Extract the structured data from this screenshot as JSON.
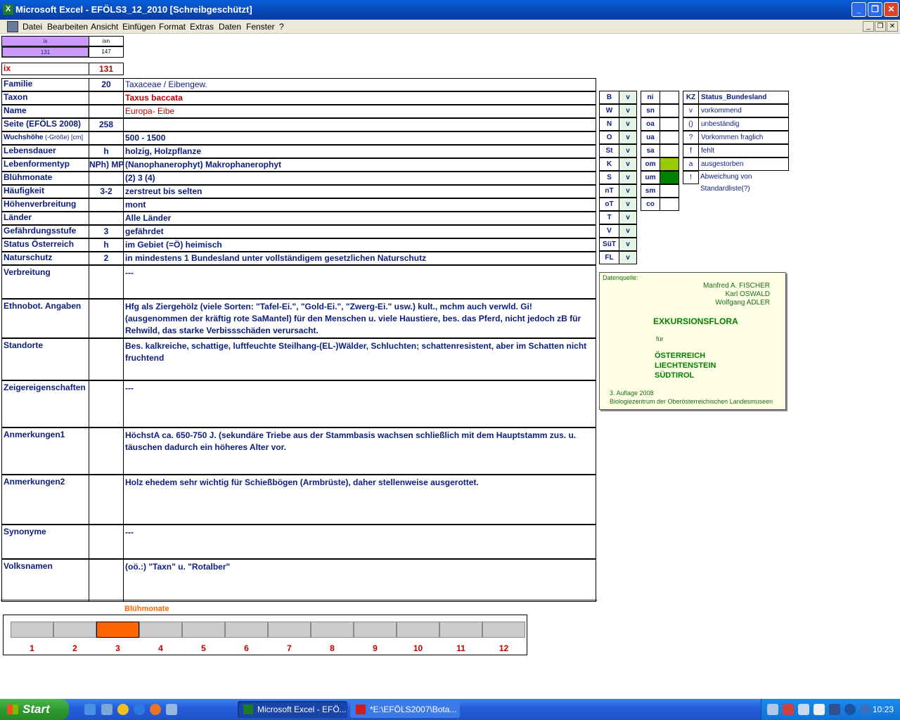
{
  "window": {
    "title": "Microsoft Excel - EFÖLS3_12_2010  [Schreibgeschützt]",
    "app_icon": "X",
    "min_label": "_",
    "max_label": "❐",
    "close_label": "✕"
  },
  "menu": {
    "items": [
      "Datei",
      "Bearbeiten",
      "Ansicht",
      "Einfügen",
      "Format",
      "Extras",
      "Daten",
      "Fenster",
      "?"
    ]
  },
  "top": {
    "ix_header": "ix",
    "ixn_header": "ixn",
    "ix_value": "131",
    "ixn_value": "147",
    "ix_label": "ix",
    "ix_big": "131"
  },
  "rows": [
    {
      "label": "Familie",
      "code": "20",
      "value": "Taxaceae  /  Eibengew."
    },
    {
      "label": "Taxon",
      "code": "",
      "value": "Taxus baccata"
    },
    {
      "label": "Name",
      "code": "",
      "value": "Europa- Eibe"
    },
    {
      "label": "Seite (EFÖLS 2008)",
      "code": "258",
      "value": ""
    },
    {
      "label": "Wuchshöhe",
      "label_suffix": " (-Größe) [cm]",
      "code": "",
      "value": "500 - 1500"
    },
    {
      "label": "Lebensdauer",
      "code": "h",
      "value": "holzig, Holzpflanze"
    },
    {
      "label": "Lebenformentyp",
      "code": "NPh) MPh",
      "value": "(Nanophanerophyt) Makrophanerophyt"
    },
    {
      "label": "Blühmonate",
      "code": "",
      "value": "(2) 3 (4)"
    },
    {
      "label": "Häufigkeit",
      "code": "3-2",
      "value": "zerstreut bis selten"
    },
    {
      "label": "Höhenverbreitung",
      "code": "",
      "value": "mont"
    },
    {
      "label": "Länder",
      "code": "",
      "value": "Alle Länder"
    },
    {
      "label": "Gefährdungsstufe",
      "code": "3",
      "value": "gefährdet"
    },
    {
      "label": "Status Österreich",
      "code": "h",
      "value": "im Gebiet (=Ö) heimisch"
    },
    {
      "label": "Naturschutz",
      "code": "2",
      "value": "in mindestens 1 Bundesland unter vollständigem gesetzlichen Naturschutz"
    }
  ],
  "big_rows": [
    {
      "label": "Verbreitung",
      "value": "---"
    },
    {
      "label": "Ethnobot. Angaben",
      "value": "Hfg als Ziergehölz (viele Sorten: \"Tafel-Ei.\", \"Gold-Ei.\", \"Zwerg-Ei.\" usw.) kult., mchm auch verwld. Gi! (ausgenommen der kräftig rote SaMantel) für den Menschen u. viele Haustiere, bes. das Pferd, nicht jedoch zB für Rehwild, das starke Verbissschäden verursacht."
    },
    {
      "label": "Standorte",
      "value": "Bes. kalkreiche, schattige, luftfeuchte Steilhang-(EL-)Wälder, Schluchten; schattenresistent, aber im Schatten nicht fruchtend"
    },
    {
      "label": "Zeigereigenschaften",
      "value": "---"
    },
    {
      "label": "Anmerkungen1",
      "value": "HöchstA ca. 650-750 J. (sekundäre Triebe aus der Stammbasis wachsen schließlich mit dem Hauptstamm zus. u. täuschen dadurch ein höheres Alter vor."
    },
    {
      "label": "Anmerkungen2",
      "value": "Holz ehedem sehr wichtig für Schießbögen (Armbrüste), daher stellenweise ausgerottet."
    },
    {
      "label": "Synonyme",
      "value": "---"
    },
    {
      "label": "Volksnamen",
      "value": "(oö.:) \"Taxn\" u. \"Rotalber\""
    }
  ],
  "legend1": [
    {
      "k": "B",
      "v": "v"
    },
    {
      "k": "W",
      "v": "v"
    },
    {
      "k": "N",
      "v": "v"
    },
    {
      "k": "O",
      "v": "v"
    },
    {
      "k": "St",
      "v": "v"
    },
    {
      "k": "K",
      "v": "v"
    },
    {
      "k": "S",
      "v": "v"
    },
    {
      "k": "nT",
      "v": "v"
    },
    {
      "k": "oT",
      "v": "v"
    },
    {
      "k": "T",
      "v": "v"
    },
    {
      "k": "V",
      "v": "v"
    },
    {
      "k": "SüT",
      "v": "v"
    },
    {
      "k": "FL",
      "v": "v"
    }
  ],
  "legend2": [
    {
      "k": "ni",
      "fill": ""
    },
    {
      "k": "sn",
      "fill": ""
    },
    {
      "k": "oa",
      "fill": ""
    },
    {
      "k": "ua",
      "fill": ""
    },
    {
      "k": "sa",
      "fill": ""
    },
    {
      "k": "om",
      "fill": "#99cc00"
    },
    {
      "k": "um",
      "fill": "#008000"
    },
    {
      "k": "sm",
      "fill": ""
    },
    {
      "k": "co",
      "fill": ""
    }
  ],
  "legend3": {
    "header_kz": "KZ",
    "header_title": "Status_Bundesland",
    "items": [
      {
        "k": "v",
        "t": "vorkommend"
      },
      {
        "k": "()",
        "t": "unbeständig"
      },
      {
        "k": "?",
        "t": "Vorkommen fraglich"
      },
      {
        "k": "f",
        "t": "fehlt"
      },
      {
        "k": "a",
        "t": "ausgestorben"
      },
      {
        "k": "!",
        "t": "Abweichung von Standardliste(?)"
      }
    ]
  },
  "source": {
    "label": "Datenquelle:",
    "author1": "Manfred A. FISCHER",
    "author2": "Karl OSWALD",
    "author3": "Wolfgang ADLER",
    "title": "EXKURSIONSFLORA",
    "fuer": "für",
    "country1": "ÖSTERREICH",
    "country2": "LIECHTENSTEIN",
    "country3": "SÜDTIROL",
    "edition": "3. Auflage 2008",
    "publisher": "Biologiezentrum der Oberösterreichischen Landesmuseen"
  },
  "chart_data": {
    "type": "bar",
    "title": "Blühmonate",
    "categories": [
      "1",
      "2",
      "3",
      "4",
      "5",
      "6",
      "7",
      "8",
      "9",
      "10",
      "11",
      "12"
    ],
    "values": [
      0,
      0,
      1,
      0,
      0,
      0,
      0,
      0,
      0,
      0,
      0,
      0
    ],
    "colors": {
      "active": "#ff6600",
      "inactive": "#cccccc"
    }
  },
  "taskbar": {
    "start": "Start",
    "task1": "Microsoft Excel - EFÖ...",
    "task2": "*E:\\EFÖLS2007\\Bota...",
    "clock": "10:23"
  }
}
